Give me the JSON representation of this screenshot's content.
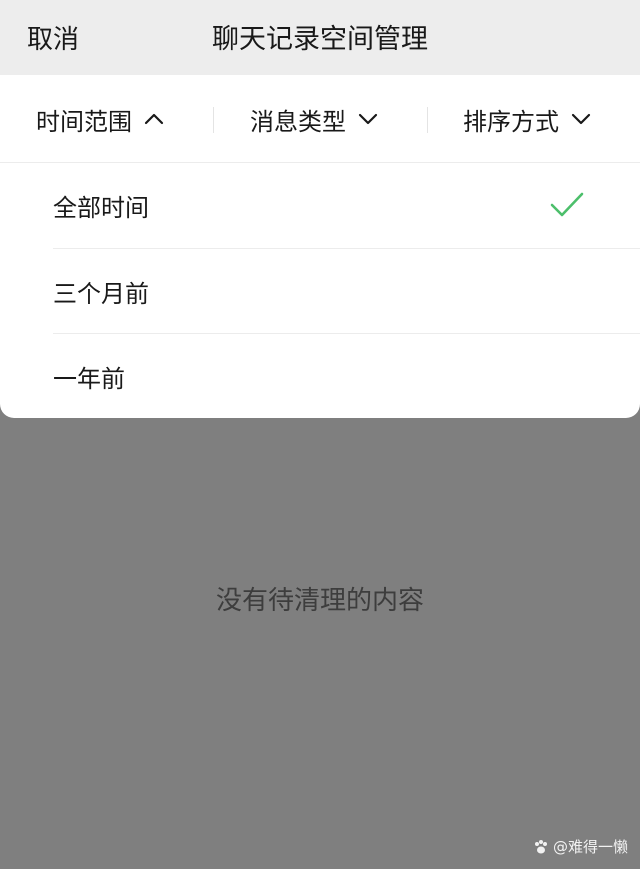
{
  "header": {
    "cancel_label": "取消",
    "title": "聊天记录空间管理"
  },
  "filters": [
    {
      "label": "时间范围",
      "expanded": true
    },
    {
      "label": "消息类型",
      "expanded": false
    },
    {
      "label": "排序方式",
      "expanded": false
    }
  ],
  "time_options": [
    {
      "label": "全部时间",
      "selected": true
    },
    {
      "label": "三个月前",
      "selected": false
    },
    {
      "label": "一年前",
      "selected": false
    }
  ],
  "empty_message": "没有待清理的内容",
  "watermark": "@难得一懒",
  "colors": {
    "header_bg": "#ededed",
    "overlay_bg": "#7f7f7f",
    "check": "#4cbf6b",
    "text": "#191919"
  },
  "icons": {
    "expanded_chevron": "chevron-up-icon",
    "collapsed_chevron": "chevron-down-icon",
    "selected": "checkmark-icon",
    "watermark_logo": "paw-icon"
  }
}
